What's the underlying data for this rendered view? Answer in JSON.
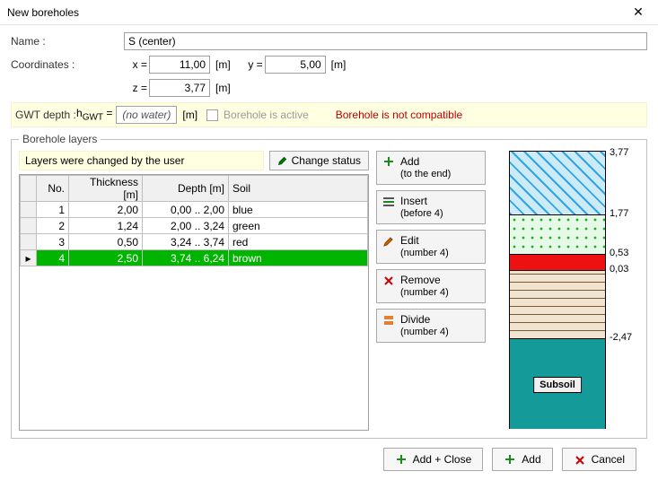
{
  "window": {
    "title": "New boreholes",
    "close": "✕"
  },
  "labels": {
    "name": "Name :",
    "coords": "Coordinates :",
    "x_eq": "x =",
    "y_eq": "y =",
    "z_eq": "z =",
    "gwt": "GWT depth :",
    "hgwt": "hGWT =",
    "unit_m": "[m]",
    "active": "Borehole is active",
    "legend": "Borehole layers",
    "status_msg": "Layers were changed by the user",
    "change_status": "Change status",
    "subsoil": "Subsoil"
  },
  "fields": {
    "name": "S (center)",
    "x": "11,00",
    "y": "5,00",
    "z": "3,77",
    "hgwt": "(no water)"
  },
  "warning": "Borehole is not compatible",
  "grid": {
    "headers": {
      "no": "No.",
      "th": "Thickness [m]",
      "depth": "Depth [m]",
      "soil": "Soil"
    },
    "rows": [
      {
        "no": "1",
        "th": "2,00",
        "depth": "0,00 .. 2,00",
        "soil": "blue"
      },
      {
        "no": "2",
        "th": "1,24",
        "depth": "2,00 .. 3,24",
        "soil": "green"
      },
      {
        "no": "3",
        "th": "0,50",
        "depth": "3,24 .. 3,74",
        "soil": "red"
      },
      {
        "no": "4",
        "th": "2,50",
        "depth": "3,74 .. 6,24",
        "soil": "brown"
      }
    ],
    "selected_marker": "▸"
  },
  "actions": {
    "add": {
      "title": "Add",
      "sub": "(to the end)"
    },
    "insert": {
      "title": "Insert",
      "sub": "(before 4)"
    },
    "edit": {
      "title": "Edit",
      "sub": "(number 4)"
    },
    "remove": {
      "title": "Remove",
      "sub": "(number 4)"
    },
    "divide": {
      "title": "Divide",
      "sub": "(number 4)"
    }
  },
  "viz_ticks": {
    "t0": "3,77",
    "t1": "1,77",
    "t2": "0,53",
    "t3": "0,03",
    "t4": "-2,47"
  },
  "footer": {
    "add_close": "Add + Close",
    "add": "Add",
    "cancel": "Cancel"
  },
  "colors": {
    "accent_yellow": "#ffffe1",
    "warn_red": "#c00000",
    "sel_green": "#00b400"
  }
}
